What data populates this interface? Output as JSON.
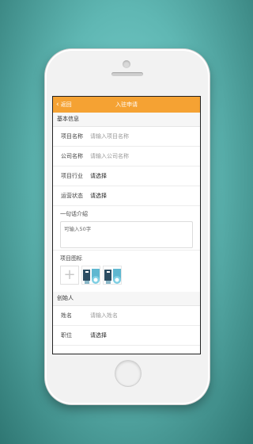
{
  "topbar": {
    "back_label": "返回",
    "title": "入驻申请"
  },
  "basic_info": {
    "header": "基本信息",
    "project_name": {
      "label": "项目名称",
      "placeholder": "请输入项目名称"
    },
    "company_name": {
      "label": "公司名称",
      "placeholder": "请输入公司名称"
    },
    "industry": {
      "label": "项目行业",
      "value": "请选择"
    },
    "status": {
      "label": "运营状态",
      "value": "请选择"
    },
    "intro": {
      "label": "一句话介绍",
      "placeholder": "可输入50字"
    },
    "project_icon": {
      "label": "项目图标",
      "thumb_count": 2
    }
  },
  "founder": {
    "header": "创始人",
    "name": {
      "label": "姓名",
      "placeholder": "请输入姓名"
    },
    "position": {
      "label": "职位",
      "value": "请选择"
    }
  },
  "colors": {
    "accent": "#f5a233",
    "section_bg": "#f6f6f6"
  }
}
